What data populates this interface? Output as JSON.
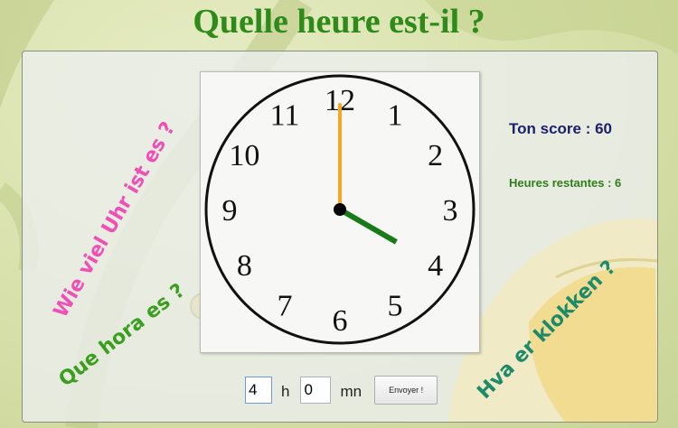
{
  "title": "Quelle heure est-il ?",
  "questions": {
    "german": "Wie viel Uhr ist es ?",
    "portuguese": "Que hora es ?",
    "norwegian": "Hva er klokken ?"
  },
  "score": {
    "label": "Ton score : 60"
  },
  "remaining": {
    "label": "Heures restantes : 6"
  },
  "clock": {
    "numerals": [
      "12",
      "1",
      "2",
      "3",
      "4",
      "5",
      "6",
      "7",
      "8",
      "9",
      "10",
      "11"
    ],
    "time_shown": {
      "hours": 4,
      "minutes": 0
    },
    "hour_hand_color": "#1a7a1a",
    "minute_hand_color": "#f5a623"
  },
  "answer": {
    "hours_value": "4",
    "hours_unit": "h",
    "minutes_value": "0",
    "minutes_unit": "mn",
    "submit_label": "Envoyer !"
  },
  "colors": {
    "title": "#2e8b1a",
    "german": "#f04fb5",
    "portuguese": "#3a9e1e",
    "norwegian": "#1d8a6a",
    "score": "#1a1f6e",
    "remaining": "#2e7d1a"
  }
}
